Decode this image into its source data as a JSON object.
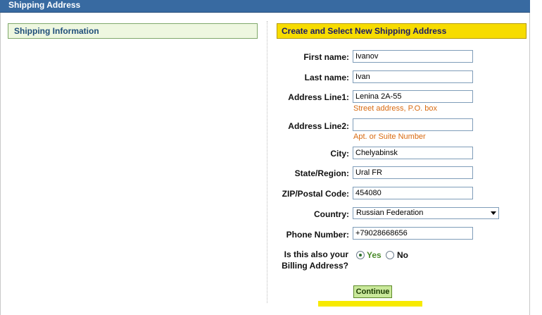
{
  "titlebar": {
    "title": "Shipping Address"
  },
  "left_header": {
    "title": "Shipping Information"
  },
  "right_header": {
    "title": "Create and Select New Shipping Address"
  },
  "form": {
    "first_name": {
      "label": "First name:",
      "value": "Ivanov"
    },
    "last_name": {
      "label": "Last name:",
      "value": "Ivan"
    },
    "address1": {
      "label": "Address Line1:",
      "value": "Lenina 2A-55",
      "hint": "Street address, P.O. box"
    },
    "address2": {
      "label": "Address Line2:",
      "value": "",
      "hint": "Apt. or Suite Number"
    },
    "city": {
      "label": "City:",
      "value": "Chelyabinsk"
    },
    "state": {
      "label": "State/Region:",
      "value": "Ural FR"
    },
    "zip": {
      "label": "ZIP/Postal Code:",
      "value": "454080"
    },
    "country": {
      "label": "Country:",
      "selected": "Russian Federation"
    },
    "phone": {
      "label": "Phone Number:",
      "value": "+79028668656"
    },
    "billing": {
      "label_line1": "Is this also your",
      "label_line2": "Billing Address?",
      "yes": "Yes",
      "no": "No",
      "selected": "Yes"
    },
    "continue_label": "Continue"
  },
  "colors": {
    "titlebar": "#386aa1",
    "right_header": "#f7dc00",
    "left_header": "#eef7e0",
    "hint": "#d86a10",
    "button": "#c9e89a"
  }
}
